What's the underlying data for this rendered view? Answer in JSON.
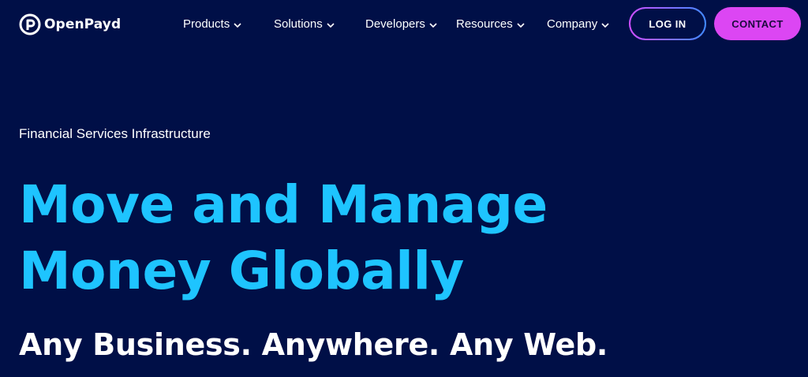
{
  "brand": {
    "name": "OpenPayd",
    "icon": "openpayd-logo-icon"
  },
  "nav": {
    "items": [
      {
        "label": "Products",
        "icon": "chevron-down-icon"
      },
      {
        "label": "Solutions",
        "icon": "chevron-down-icon"
      },
      {
        "label": "Developers",
        "icon": "chevron-down-icon"
      },
      {
        "label": "Resources",
        "icon": "chevron-down-icon"
      },
      {
        "label": "Company",
        "icon": "chevron-down-icon"
      }
    ]
  },
  "actions": {
    "login_label": "LOG IN",
    "contact_label": "CONTACT"
  },
  "hero": {
    "eyebrow": "Financial Services Infrastructure",
    "headline_line1": "Move and Manage",
    "headline_line2": "Money Globally",
    "subheadline": "Any Business. Anywhere. Any Web."
  },
  "colors": {
    "background": "#000f47",
    "headline": "#1ec4ff",
    "contact_button": "#dc46f3",
    "login_border_start": "#d24cff",
    "login_border_end": "#3a8dff"
  }
}
